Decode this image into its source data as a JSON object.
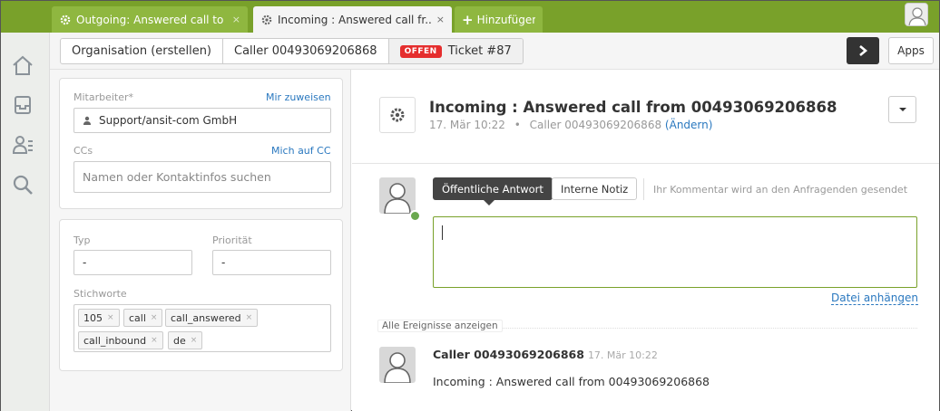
{
  "tabs": [
    {
      "label": "Outgoing: Answered call to ...",
      "close": "×"
    },
    {
      "label": "Incoming : Answered call fr...",
      "close": "×"
    },
    {
      "label": "Hinzufügen",
      "plus": "+"
    }
  ],
  "icons": {
    "tab_gear": "gear-icon",
    "nav": [
      "home-icon",
      "inbox-icon",
      "customers-icon",
      "search-icon"
    ],
    "next": "chevron-right-icon",
    "dropdown": "caret-down-icon",
    "assignee": "user-icon"
  },
  "colors": {
    "accent": "#79a12a",
    "accent_light": "#8fb740",
    "badge_red": "#e52e2e",
    "link": "#2a78bf",
    "online": "#6aa84f"
  },
  "breadcrumb": {
    "organisation": "Organisation (erstellen)",
    "caller": "Caller 00493069206868",
    "status_badge": "OFFEN",
    "ticket": "Ticket #87"
  },
  "toolbar": {
    "next_label": "›",
    "apps_label": "Apps"
  },
  "assignment": {
    "agent_label": "Mitarbeiter*",
    "assign_me": "Mir zuweisen",
    "agent_value": "Support/ansit-com GmbH",
    "ccs_label": "CCs",
    "cc_me": "Mich auf CC",
    "cc_placeholder": "Namen oder Kontaktinfos suchen"
  },
  "properties": {
    "type_label": "Typ",
    "type_value": "-",
    "priority_label": "Priorität",
    "priority_value": "-",
    "tags_label": "Stichworte",
    "tags": [
      "105",
      "call",
      "call_answered",
      "call_inbound",
      "de"
    ],
    "tag_remove": "×"
  },
  "ticket": {
    "title": "Incoming : Answered call from 00493069206868",
    "date": "17. Mär 10:22",
    "separator": "•",
    "requester": "Caller 00493069206868",
    "change": "(Ändern)"
  },
  "composer": {
    "public_reply": "Öffentliche Antwort",
    "internal_note": "Interne Notiz",
    "hint": "Ihr Kommentar wird an den Anfragenden gesendet",
    "attach": "Datei anhängen"
  },
  "events": {
    "show_all": "Alle Ereignisse anzeigen"
  },
  "message": {
    "author": "Caller 00493069206868",
    "time": "17. Mär 10:22",
    "body": "Incoming : Answered call from 00493069206868"
  }
}
